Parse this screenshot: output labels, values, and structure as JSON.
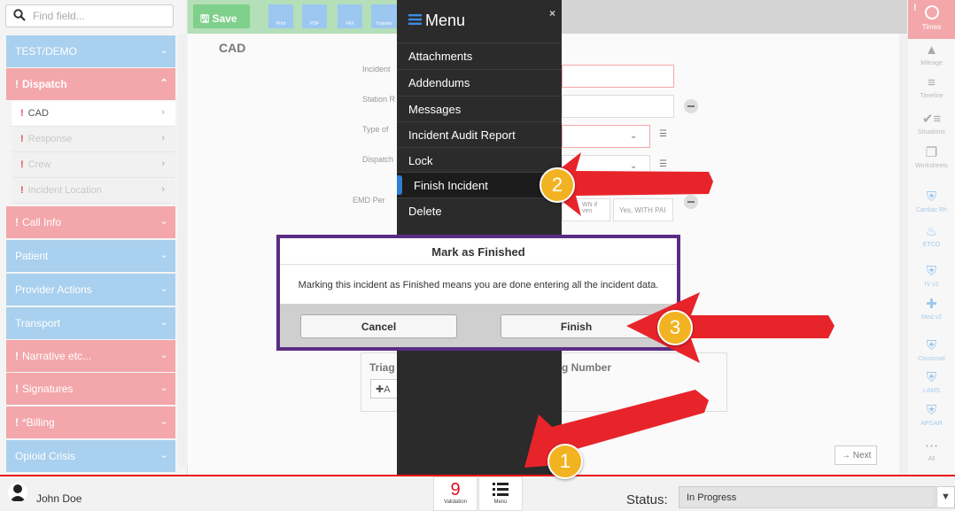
{
  "search": {
    "placeholder": "Find field..."
  },
  "sidebar": {
    "sections": [
      {
        "label": "TEST/DEMO",
        "required": false,
        "expanded": false
      },
      {
        "label": "Dispatch",
        "required": true,
        "expanded": true
      },
      {
        "label": "Call Info",
        "required": true,
        "expanded": false
      },
      {
        "label": "Patient",
        "required": false,
        "expanded": false
      },
      {
        "label": "Provider Actions",
        "required": false,
        "expanded": false
      },
      {
        "label": "Transport",
        "required": false,
        "expanded": false
      },
      {
        "label": "Narrative etc...",
        "required": true,
        "expanded": false
      },
      {
        "label": "Signatures",
        "required": true,
        "expanded": false
      },
      {
        "label": "*Billing",
        "required": true,
        "expanded": false
      },
      {
        "label": "Opioid Crisis",
        "required": false,
        "expanded": false
      }
    ],
    "dispatch_items": [
      {
        "label": "CAD",
        "active": true
      },
      {
        "label": "Response",
        "active": false
      },
      {
        "label": "Crew",
        "active": false
      },
      {
        "label": "Incident Location",
        "active": false
      }
    ]
  },
  "toolbar": {
    "save_label": "Save",
    "tools": [
      "Print",
      "PDF",
      "FAX",
      "Transfer"
    ]
  },
  "content": {
    "title": "CAD",
    "fields": [
      "Incident",
      "Station R",
      "Type of",
      "Dispatch",
      "EMD Per"
    ],
    "emd_options": [
      "WN if\nven",
      "Yes, WITH PAI"
    ],
    "lower_labels": [
      "Triag",
      "g Number"
    ],
    "add_label": "A",
    "next_label": "Next"
  },
  "menu": {
    "title": "Menu",
    "items": [
      "Attachments",
      "Addendums",
      "Messages",
      "Incident Audit Report",
      "Lock",
      "Finish Incident",
      "Delete"
    ],
    "active_index": 5
  },
  "modal": {
    "title": "Mark as Finished",
    "message": "Marking this incident as Finished means you are done entering all the incident data.",
    "cancel_label": "Cancel",
    "finish_label": "Finish"
  },
  "rail": {
    "times_label": "Times",
    "items": [
      {
        "label": "Mileage",
        "icon": "road-icon"
      },
      {
        "label": "Timeline",
        "icon": "sliders-icon"
      },
      {
        "label": "Situations",
        "icon": "check-list-icon"
      },
      {
        "label": "Worksheets",
        "icon": "copy-icon"
      },
      {
        "label": "Cardiac Rh",
        "icon": "medkit-icon"
      },
      {
        "label": "ETCO",
        "icon": "lungs-icon"
      },
      {
        "label": "IV v2",
        "icon": "medkit-icon"
      },
      {
        "label": "Med v2",
        "icon": "pill-icon"
      },
      {
        "label": "Cincinnati",
        "icon": "medkit-icon"
      },
      {
        "label": "LAMS",
        "icon": "medkit-icon"
      },
      {
        "label": "APGAR",
        "icon": "medkit-icon"
      },
      {
        "label": "All",
        "icon": "dots-icon"
      }
    ]
  },
  "bottom": {
    "user_name": "John Doe",
    "validation_count": "9",
    "validation_label": "Validation",
    "menu_label": "Menu",
    "status_label": "Status:",
    "status_value": "In Progress"
  },
  "annotations": [
    "1",
    "2",
    "3"
  ],
  "colors": {
    "accent_red": "#e8242b",
    "badge": "#f1b321",
    "modal_border": "#5b2c83",
    "menu_bg": "#2b2b2b"
  }
}
